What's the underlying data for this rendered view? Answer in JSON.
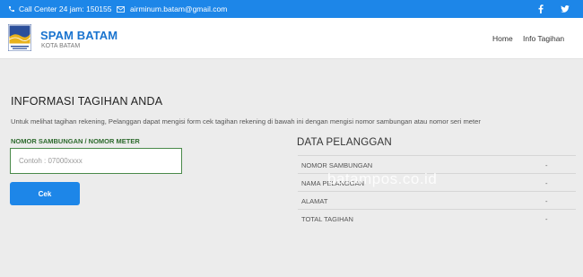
{
  "topbar": {
    "phone_icon": "phone-icon",
    "call_center": "Call Center 24 jam: 150155",
    "email_icon": "envelope-icon",
    "email": "airminum.batam@gmail.com",
    "social": [
      "facebook-icon",
      "twitter-icon"
    ]
  },
  "header": {
    "logo": "spam-batam-logo",
    "title": "SPAM BATAM",
    "subtitle": "KOTA BATAM",
    "nav": [
      "Home",
      "Info Tagihan"
    ]
  },
  "main": {
    "title": "INFORMASI TAGIHAN ANDA",
    "description": "Untuk melihat tagihan rekening, Pelanggan dapat mengisi form cek tagihan rekening di bawah ini dengan mengisi nomor sambungan atau nomor seri meter",
    "field_label": "NOMOR SAMBUNGAN / NOMOR METER",
    "input_placeholder": "Contoh : 07000xxxx",
    "input_value": "",
    "button_label": "Cek"
  },
  "customer": {
    "title": "DATA PELANGGAN",
    "rows": [
      {
        "label": "NOMOR SAMBUNGAN",
        "value": "-"
      },
      {
        "label": "NAMA PELANGGAN",
        "value": "-"
      },
      {
        "label": "ALAMAT",
        "value": "-"
      },
      {
        "label": "TOTAL TAGIHAN",
        "value": "-"
      }
    ]
  },
  "watermark": "batampos.co.id",
  "colors": {
    "primary": "#1d86e8",
    "brand_title": "#1a74cf",
    "label_green": "#2e6b2e",
    "input_border": "#4a8a4a",
    "background": "#ececec"
  }
}
